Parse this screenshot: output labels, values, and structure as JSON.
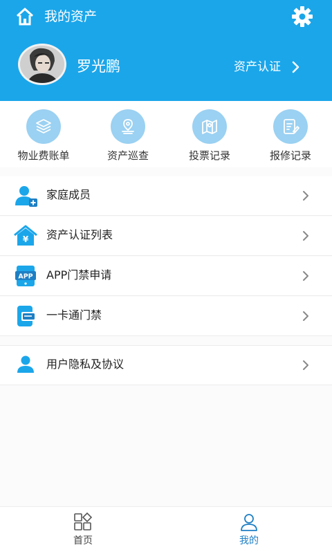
{
  "header": {
    "title": "我的资产",
    "username": "罗光鹏",
    "auth_label": "资产认证",
    "bg_color": "#1ba6ea"
  },
  "quick_actions": [
    {
      "label": "物业费账单",
      "icon": "bill-stack-icon"
    },
    {
      "label": "资产巡查",
      "icon": "location-pin-icon"
    },
    {
      "label": "投票记录",
      "icon": "map-icon"
    },
    {
      "label": "报修记录",
      "icon": "repair-form-icon"
    }
  ],
  "menu": [
    {
      "label": "家庭成员",
      "icon": "add-user-icon"
    },
    {
      "label": "资产认证列表",
      "icon": "house-yuan-icon"
    },
    {
      "label": "APP门禁申请",
      "icon": "app-icon"
    },
    {
      "label": "一卡通门禁",
      "icon": "card-icon"
    },
    {
      "label": "用户隐私及协议",
      "icon": "user-icon"
    }
  ],
  "tabbar": [
    {
      "label": "首页",
      "icon": "grid-icon",
      "active": false
    },
    {
      "label": "我的",
      "icon": "person-icon",
      "active": true
    }
  ],
  "colors": {
    "accent": "#1ba6ea",
    "icon_circle": "#9bd1f2",
    "active_tab": "#1e7fc4"
  }
}
